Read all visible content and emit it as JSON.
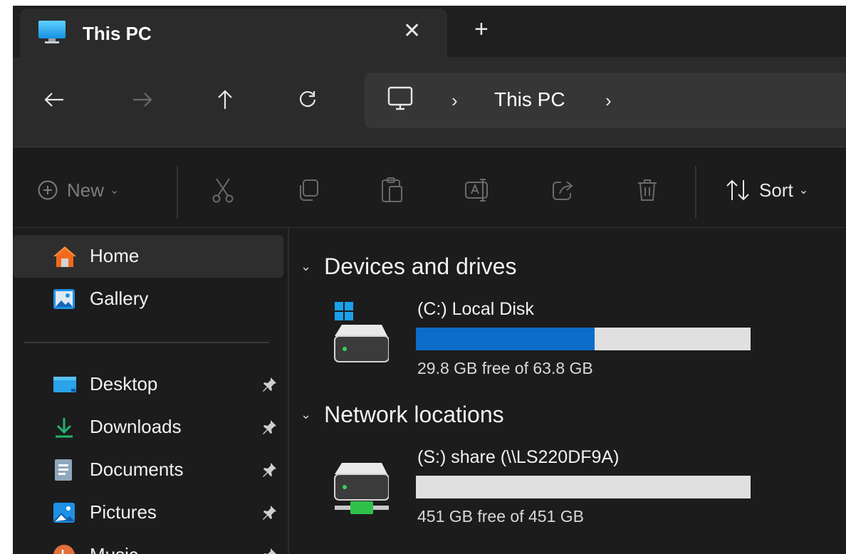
{
  "tab": {
    "title": "This PC",
    "close_glyph": "✕",
    "newtab_glyph": "+"
  },
  "address": {
    "separator": "›",
    "crumb": "This PC"
  },
  "toolbar": {
    "new_label": "New",
    "sort_label": "Sort",
    "chevron": "⌄"
  },
  "sidebar": {
    "items": [
      {
        "label": "Home",
        "icon": "home-icon"
      },
      {
        "label": "Gallery",
        "icon": "gallery-icon"
      },
      {
        "label": "Desktop",
        "icon": "desktop-icon"
      },
      {
        "label": "Downloads",
        "icon": "downloads-icon"
      },
      {
        "label": "Documents",
        "icon": "documents-icon"
      },
      {
        "label": "Pictures",
        "icon": "pictures-icon"
      },
      {
        "label": "Music",
        "icon": "music-icon"
      }
    ]
  },
  "groups": {
    "devices": {
      "title": "Devices and drives",
      "chevron": "⌄"
    },
    "network": {
      "title": "Network locations",
      "chevron": "⌄"
    }
  },
  "drives": [
    {
      "name": "(C:) Local Disk",
      "free_text": "29.8 GB free of 63.8 GB",
      "used_fraction": 0.533
    },
    {
      "name": "(S:) share (\\\\LS220DF9A)",
      "free_text": "451 GB free of 451 GB",
      "used_fraction": 0.0
    }
  ],
  "colors": {
    "accent": "#0b6cc9",
    "bar_bg": "#e0e0e0",
    "bg": "#1c1c1c"
  }
}
